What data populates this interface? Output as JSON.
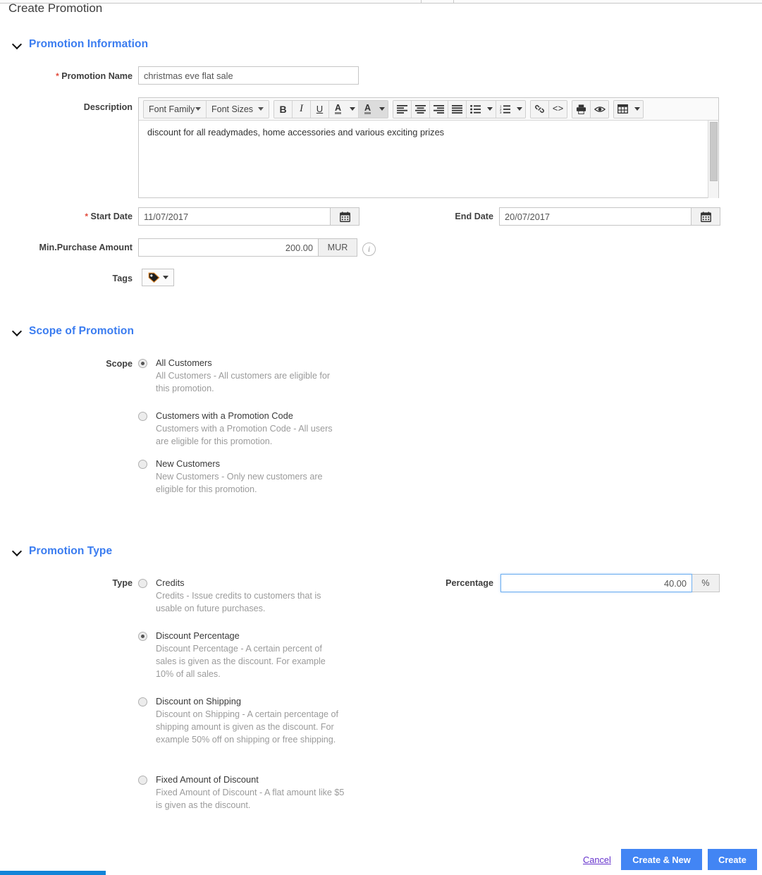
{
  "page": {
    "title": "Create Promotion"
  },
  "sections": {
    "information": {
      "title": "Promotion Information"
    },
    "scope": {
      "title": "Scope of Promotion"
    },
    "type": {
      "title": "Promotion Type"
    }
  },
  "fields": {
    "promotion_name": {
      "label": "Promotion Name",
      "value": "christmas eve flat sale",
      "required": true
    },
    "description": {
      "label": "Description",
      "value": "discount for all readymades, home accessories and various exciting prizes"
    },
    "start_date": {
      "label": "Start Date",
      "value": "11/07/2017",
      "required": true
    },
    "end_date": {
      "label": "End Date",
      "value": "20/07/2017"
    },
    "min_purchase": {
      "label": "Min.Purchase Amount",
      "value": "200.00",
      "currency": "MUR"
    },
    "tags": {
      "label": "Tags"
    },
    "percentage": {
      "label": "Percentage",
      "value": "40.00",
      "unit": "%"
    }
  },
  "editor_toolbar": {
    "font_family": "Font Family",
    "font_sizes": "Font Sizes",
    "bold": "B",
    "italic": "I",
    "underline": "U",
    "text_color": "A",
    "background_color": "A"
  },
  "scope": {
    "label": "Scope",
    "options": [
      {
        "title": "All Customers",
        "desc": "All Customers - All customers are eligible for this promotion.",
        "selected": true
      },
      {
        "title": "Customers with a Promotion Code",
        "desc": "Customers with a Promotion Code - All users are eligible for this promotion.",
        "selected": false
      },
      {
        "title": "New Customers",
        "desc": "New Customers - Only new customers are eligible for this promotion.",
        "selected": false
      }
    ]
  },
  "promotion_type": {
    "label": "Type",
    "options": [
      {
        "title": "Credits",
        "desc": "Credits - Issue credits to customers that is usable on future purchases.",
        "selected": false
      },
      {
        "title": "Discount Percentage",
        "desc": "Discount Percentage - A certain percent of sales is given as the discount. For example 10% of all sales.",
        "selected": true
      },
      {
        "title": "Discount on Shipping",
        "desc": "Discount on Shipping - A certain percentage of shipping amount is given as the discount. For example 50% off on shipping or free shipping.",
        "selected": false
      },
      {
        "title": "Fixed Amount of Discount",
        "desc": "Fixed Amount of Discount - A flat amount like $5 is given as the discount.",
        "selected": false
      }
    ]
  },
  "footer": {
    "cancel": "Cancel",
    "create_and_new": "Create & New",
    "create": "Create"
  },
  "colors": {
    "accent": "#3a7cf0",
    "button": "#4285f4",
    "link": "#6633cc",
    "required": "#e24a3b",
    "muted": "#9b9b9b",
    "progress": "#1284d8"
  }
}
